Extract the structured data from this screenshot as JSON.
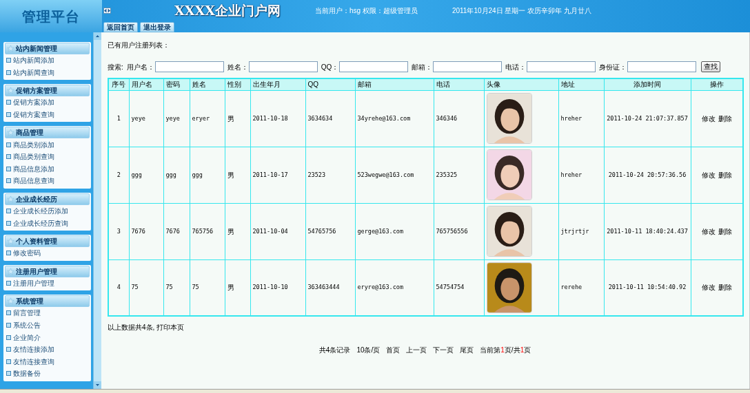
{
  "header": {
    "logo": "管理平台",
    "site_title": "XXXX企业门户网",
    "user_info": "当前用户：hsg 权限：超级管理员",
    "date": "2011年10月24日 星期一 农历辛卯年 九月廿八",
    "tabs": [
      {
        "label": "返回首页"
      },
      {
        "label": "退出登录"
      }
    ]
  },
  "sidebar": {
    "groups": [
      {
        "title": "站内新闻管理",
        "items": [
          "站内新闻添加",
          "站内新闻查询"
        ]
      },
      {
        "title": "促销方案管理",
        "items": [
          "促销方案添加",
          "促销方案查询"
        ]
      },
      {
        "title": "商品管理",
        "items": [
          "商品类别添加",
          "商品类别查询",
          "商品信息添加",
          "商品信息查询"
        ]
      },
      {
        "title": "企业成长经历",
        "items": [
          "企业成长经历添加",
          "企业成长经历查询"
        ]
      },
      {
        "title": "个人资料管理",
        "items": [
          "修改密码"
        ]
      },
      {
        "title": "注册用户管理",
        "items": [
          "注册用户管理"
        ]
      },
      {
        "title": "系统管理",
        "items": [
          "留言管理",
          "系统公告",
          "企业简介",
          "友情连接添加",
          "友情连接查询",
          "数据备份"
        ]
      }
    ]
  },
  "page_title": "已有用户注册列表：",
  "search": {
    "label": "搜索:",
    "fields": [
      "用户名：",
      "姓名：",
      "QQ：",
      "邮箱：",
      "电话：",
      "身份证："
    ],
    "button": "查找"
  },
  "table": {
    "columns": [
      "序号",
      "用户名",
      "密码",
      "姓名",
      "性别",
      "出生年月",
      "QQ",
      "邮箱",
      "电话",
      "头像",
      "地址",
      "添加时间",
      "操作"
    ],
    "rows": [
      {
        "cells": [
          "1",
          "yeye",
          "yeye",
          "eryer",
          "男",
          "2011-10-18",
          "3634634",
          "34yrehe@163.com",
          "346346"
        ],
        "address": "hreher",
        "added": "2011-10-24 21:07:37.857",
        "actions": [
          "修改",
          "删除"
        ]
      },
      {
        "cells": [
          "2",
          "ggg",
          "ggg",
          "ggg",
          "男",
          "2011-10-17",
          "23523",
          "523wegwe@163.com",
          "235325"
        ],
        "address": "hreher",
        "added": "2011-10-24 20:57:36.56",
        "actions": [
          "修改",
          "删除"
        ]
      },
      {
        "cells": [
          "3",
          "7676",
          "7676",
          "765756",
          "男",
          "2011-10-04",
          "54765756",
          "gerge@163.com",
          "765756556"
        ],
        "address": "jtrjrtjr",
        "added": "2011-10-11 18:40:24.437",
        "actions": [
          "修改",
          "删除"
        ]
      },
      {
        "cells": [
          "4",
          "75",
          "75",
          "75",
          "男",
          "2011-10-10",
          "363463444",
          "eryre@163.com",
          "54754754"
        ],
        "address": "rerehe",
        "added": "2011-10-11 10:54:40.92",
        "actions": [
          "修改",
          "删除"
        ]
      }
    ]
  },
  "summary": {
    "text": "以上数据共4条,",
    "link": "打印本页"
  },
  "pagination": {
    "items": [
      "共4条记录",
      "10条/页",
      "首页",
      "上一页",
      "下一页",
      "尾页"
    ],
    "current": {
      "prefix": "当前第",
      "page": "1",
      "mid": "页/共",
      "total": "1",
      "suffix": "页"
    }
  }
}
